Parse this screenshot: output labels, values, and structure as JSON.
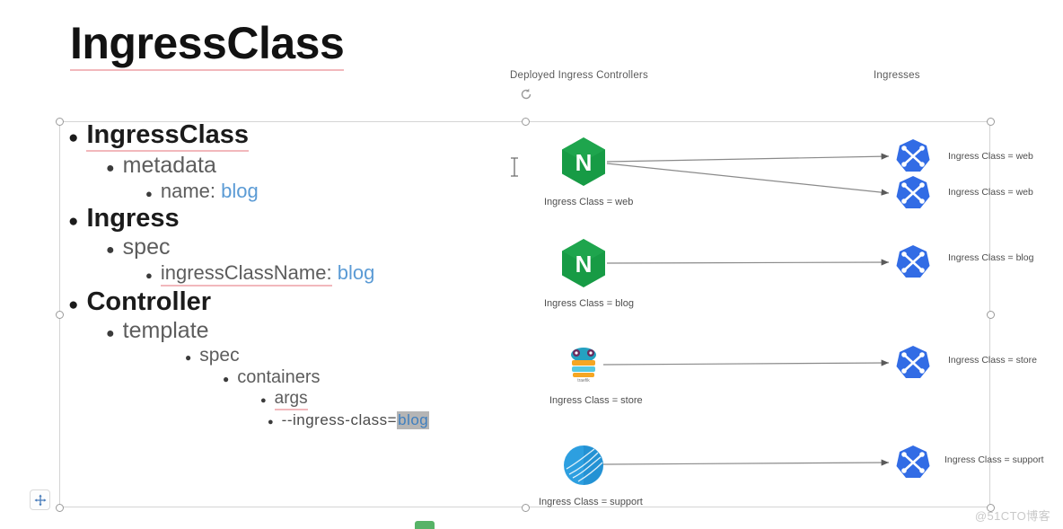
{
  "slide": {
    "title": "IngressClass",
    "title_spell_error": true
  },
  "outline": [
    {
      "level": 1,
      "text": "IngressClass",
      "spell_error": true
    },
    {
      "level": 2,
      "text": "metadata"
    },
    {
      "level": 3,
      "label": "name:",
      "value": "blog"
    },
    {
      "level": 1,
      "text": "Ingress"
    },
    {
      "level": 2,
      "text": "spec"
    },
    {
      "level": 3,
      "label": "ingressClassName:",
      "value": "blog",
      "spell_error": true
    },
    {
      "level": 1,
      "text": "Controller"
    },
    {
      "level": 2,
      "text": "template"
    },
    {
      "level": 3,
      "text": "spec"
    },
    {
      "level": 4,
      "text": "containers"
    },
    {
      "level": 5,
      "text": "args",
      "spell_error": true
    },
    {
      "level": 6,
      "label": "--ingress-class=",
      "value": "blog",
      "selected": true
    }
  ],
  "outline_text": {
    "ingressclass": "IngressClass",
    "metadata": "metadata",
    "name_label": "name:",
    "name_value": "blog",
    "ingress": "Ingress",
    "spec": "spec",
    "ingressclassname_label": "ingressClassName:",
    "ingressclassname_value": "blog",
    "controller": "Controller",
    "template": "template",
    "spec2": "spec",
    "containers": "containers",
    "args": "args",
    "arg_label": "--ingress-class=",
    "arg_value": "blog"
  },
  "diagram": {
    "headers": {
      "controllers": "Deployed Ingress Controllers",
      "ingresses": "Ingresses"
    },
    "controllers": [
      {
        "icon": "nginx-logo-icon",
        "label": "Ingress Class = web",
        "color": "#179b45"
      },
      {
        "icon": "nginx-logo-icon",
        "label": "Ingress Class = blog",
        "color": "#179b45"
      },
      {
        "icon": "traefik-logo-icon",
        "label": "Ingress Class = store",
        "color": "#24a1c1"
      },
      {
        "icon": "haproxy-logo-icon",
        "label": "Ingress Class = support",
        "color": "#2d9fe0"
      }
    ],
    "ingresses": [
      {
        "icon": "kubernetes-ingress-icon",
        "label": "Ingress Class = web",
        "color": "#326ce5"
      },
      {
        "icon": "kubernetes-ingress-icon",
        "label": "Ingress Class = web",
        "color": "#326ce5"
      },
      {
        "icon": "kubernetes-ingress-icon",
        "label": "Ingress Class = blog",
        "color": "#326ce5"
      },
      {
        "icon": "kubernetes-ingress-icon",
        "label": "Ingress Class = store",
        "color": "#326ce5"
      },
      {
        "icon": "kubernetes-ingress-icon",
        "label": "Ingress Class = support",
        "color": "#326ce5"
      }
    ]
  },
  "colors": {
    "accent_blue": "#5b9bd5",
    "spell_underline": "#f2b8bc",
    "nginx_green": "#179b45",
    "k8s_blue": "#326ce5",
    "selection_gray": "#b5b5b5"
  },
  "watermark": "@51CTO博客"
}
